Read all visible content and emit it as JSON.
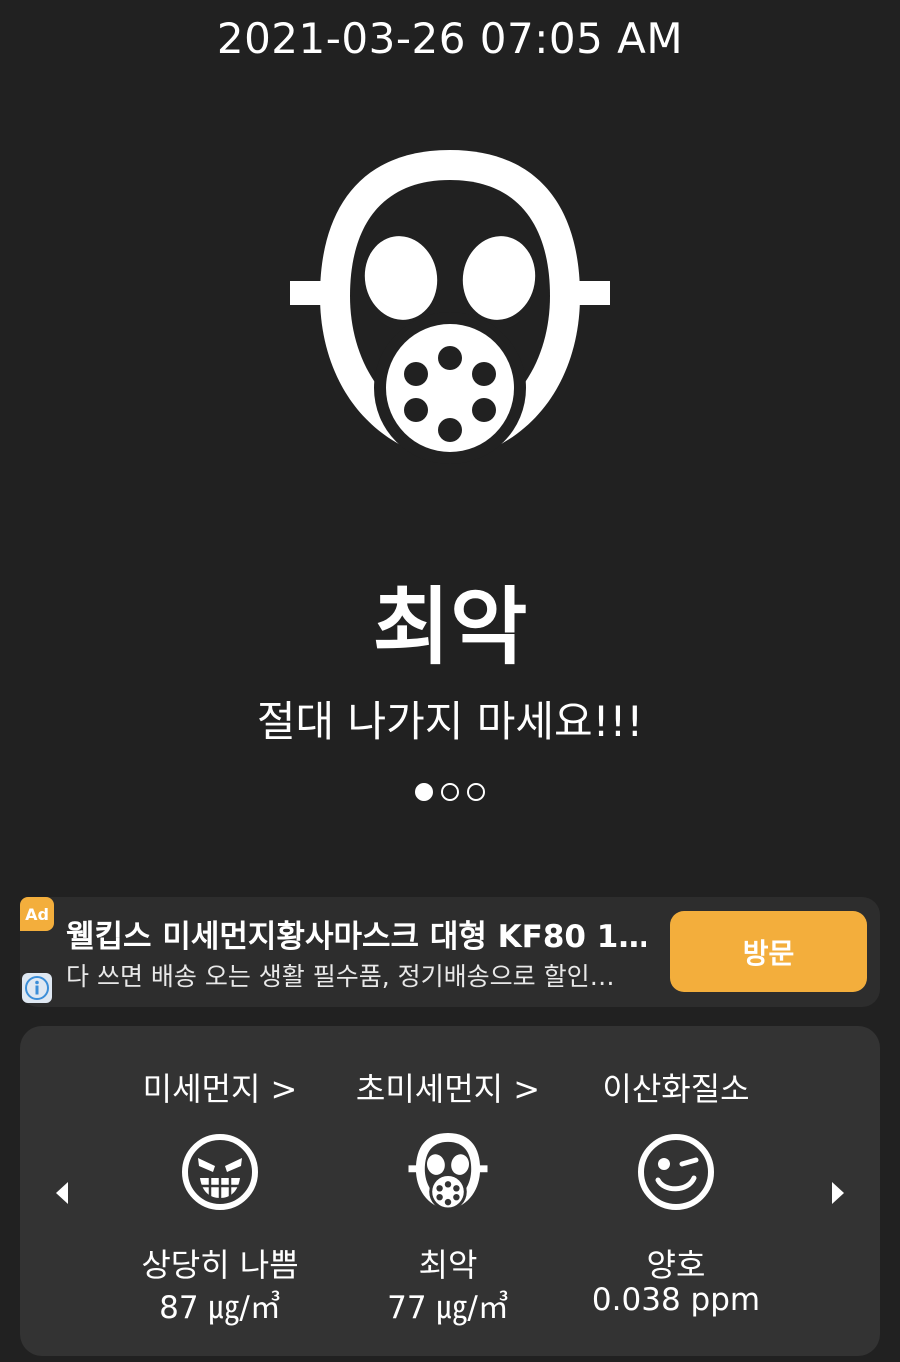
{
  "header": {
    "datetime": "2021-03-26 07:05 AM"
  },
  "hero": {
    "icon": "gas-mask-icon",
    "status": "최악",
    "message": "절대 나가지 마세요!!!",
    "pager_total": 3,
    "pager_active": 0
  },
  "ad": {
    "badge": "Ad",
    "title": "웰킵스 미세먼지황사마스크 대형 KF80 1…",
    "description": "다 쓰면 배송 오는 생활 필수품, 정기배송으로 할인…",
    "button": "방문",
    "accent": "#f3ae3c"
  },
  "metrics": [
    {
      "label": "미세먼지 >",
      "icon": "grinning-devil-face-icon",
      "status": "상당히 나쁨",
      "value": "87 ㎍/㎥"
    },
    {
      "label": "초미세먼지 >",
      "icon": "gas-mask-icon",
      "status": "최악",
      "value": "77 ㎍/㎥"
    },
    {
      "label": "이산화질소",
      "icon": "winking-face-icon",
      "status": "양호",
      "value": "0.038 ppm"
    }
  ],
  "colors": {
    "background": "#212121",
    "card": "#333333",
    "text": "#ffffff"
  }
}
